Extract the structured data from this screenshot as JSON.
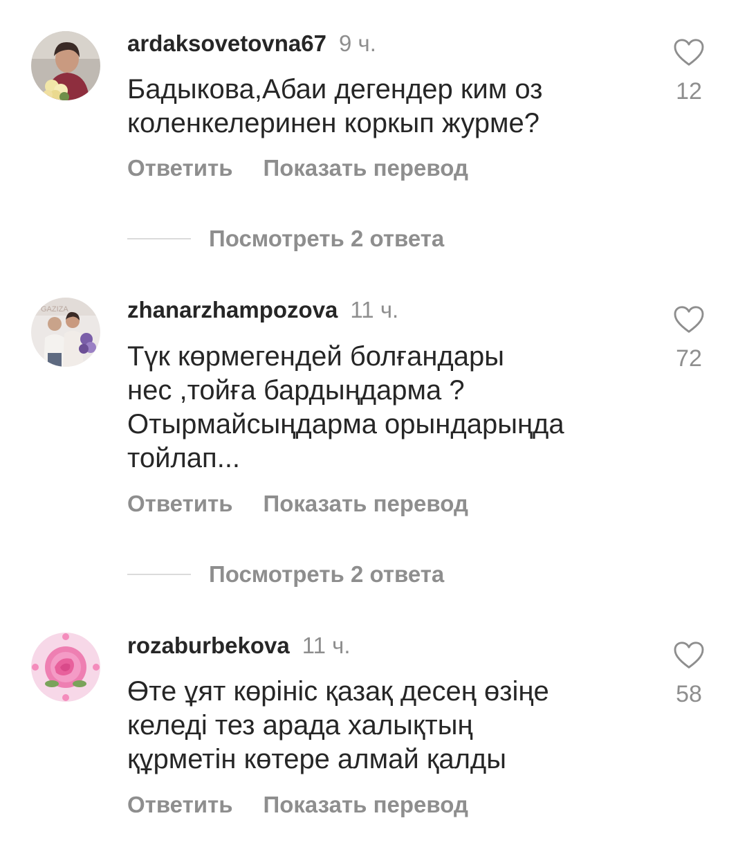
{
  "comments": [
    {
      "username": "ardaksovetovna67",
      "time": "9 ч.",
      "text": "Бадыкова,Абаи дегендер ким оз\nколенкелеринен коркып журме?",
      "likes": "12",
      "reply_label": "Ответить",
      "translate_label": "Показать перевод",
      "replies_label": "Посмотреть 2 ответа"
    },
    {
      "username": "zhanarzhampozova",
      "time": "11 ч.",
      "text": "Түк көрмегендей  болғандары\nнес ,тойға бардыңдарма ?\nОтырмайсыңдарма орындарыңда\nтойлап...",
      "likes": "72",
      "reply_label": "Ответить",
      "translate_label": "Показать перевод",
      "replies_label": "Посмотреть 2 ответа"
    },
    {
      "username": "rozaburbekova",
      "time": "11 ч.",
      "text": "Өте ұят көрініс қазақ десең өзіңе\nкеледі тез арада  халықтың\nқұрметін көтере алмай қалды",
      "likes": "58",
      "reply_label": "Ответить",
      "translate_label": "Показать перевод"
    }
  ],
  "avatar_watermark": "GAZIZA",
  "colors": {
    "text": "#262626",
    "secondary": "#8e8e8e",
    "divider": "#dbdbdb"
  },
  "icons": {
    "like": "heart-outline-icon"
  }
}
